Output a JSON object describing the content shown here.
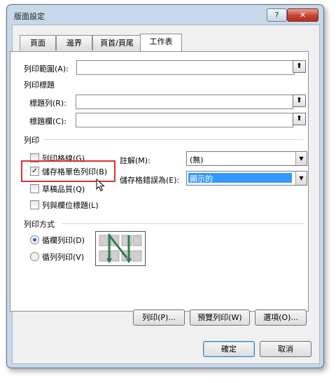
{
  "window": {
    "title": "版面設定",
    "help_label": "?",
    "close_label": "✕"
  },
  "tabs": [
    {
      "label": "頁面",
      "active": false
    },
    {
      "label": "邊界",
      "active": false
    },
    {
      "label": "頁首/頁尾",
      "active": false
    },
    {
      "label": "工作表",
      "active": true
    }
  ],
  "print_area": {
    "label": "列印範圍(A):",
    "value": ""
  },
  "print_titles": {
    "heading": "列印標題",
    "rows_label": "標題列(R):",
    "rows_value": "",
    "cols_label": "標題欄(C):",
    "cols_value": ""
  },
  "print_section": {
    "heading": "列印",
    "options": [
      {
        "label": "列印格線(G)",
        "checked": false
      },
      {
        "label": "儲存格單色列印(B)",
        "checked": true
      },
      {
        "label": "草稿品質(Q)",
        "checked": false
      },
      {
        "label": "列與欄位標題(L)",
        "checked": false
      }
    ],
    "comments": {
      "label": "註解(M):",
      "value": "(無)"
    },
    "cell_errors": {
      "label": "儲存格錯誤為(E):",
      "value": "顯示的"
    }
  },
  "page_order": {
    "heading": "列印方式",
    "options": [
      {
        "label": "循欄列印(D)",
        "selected": true
      },
      {
        "label": "循列列印(V)",
        "selected": false
      }
    ]
  },
  "buttons": {
    "print": "列印(P)...",
    "preview": "預覽列印(W)",
    "options": "選項(O)...",
    "ok": "確定",
    "cancel": "取消"
  },
  "icons": {
    "collapse": "upload-arrow-icon",
    "dropdown": "chevron-down-icon"
  },
  "colors": {
    "highlight": "#3399ff",
    "annotation": "#e03030",
    "title_bar": "#c7d8ea"
  }
}
